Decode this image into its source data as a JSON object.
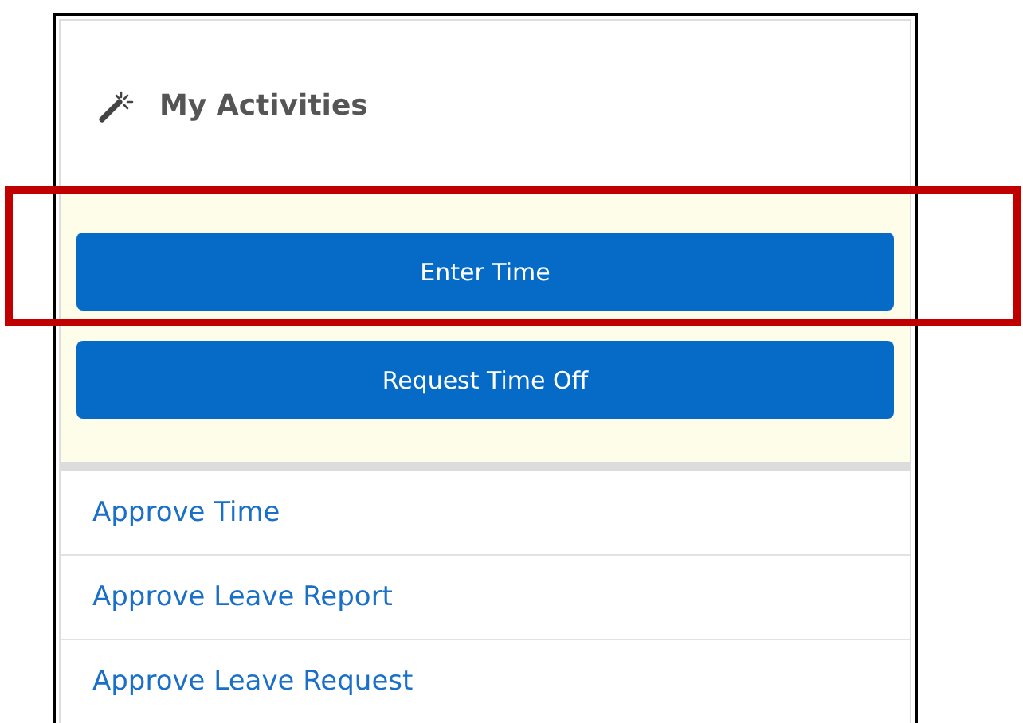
{
  "panel": {
    "title": "My Activities"
  },
  "actions": [
    {
      "label": "Enter Time",
      "highlighted": true
    },
    {
      "label": "Request Time Off",
      "highlighted": false
    }
  ],
  "links": [
    "Approve Time",
    "Approve Leave Report",
    "Approve Leave Request"
  ]
}
